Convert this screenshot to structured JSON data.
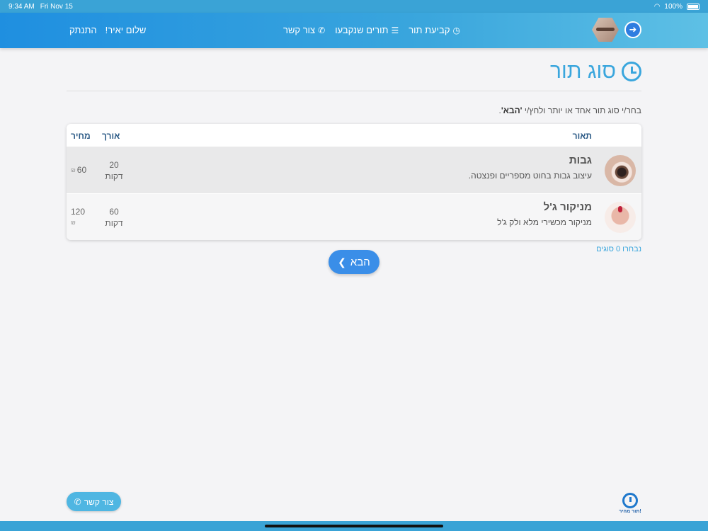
{
  "status_bar": {
    "time": "9:34 AM",
    "date": "Fri Nov 15",
    "battery": "100%"
  },
  "navbar": {
    "logout": "התנתק",
    "greeting": "שלום יאיר!",
    "items": [
      {
        "label": "קביעת תור",
        "icon": "clock-icon"
      },
      {
        "label": "תורים שנקבעו",
        "icon": "list-icon"
      },
      {
        "label": "צור קשר",
        "icon": "phone-icon"
      }
    ]
  },
  "page": {
    "title": "סוג תור",
    "instruction_prefix": "בחר/י סוג תור אחד או יותר ולחץ/י ",
    "instruction_bold": "'הבא'",
    "instruction_suffix": "."
  },
  "table": {
    "headers": {
      "description": "תאור",
      "length": "אורך",
      "price": "מחיר"
    },
    "rows": [
      {
        "name": "גבות",
        "description": "עיצוב גבות בחוט מספריים ופנצטה.",
        "length": "20",
        "length_unit": "דקות",
        "price": "60",
        "thumbnail": "eye-thumbnail"
      },
      {
        "name": "מניקור ג'ל",
        "description": "מניקור מכשירי מלא ולק ג'ל",
        "length": "60",
        "length_unit": "דקות",
        "price": "120",
        "thumbnail": "hand-thumbnail"
      }
    ]
  },
  "selected_count": "נבחרו 0 סוגים",
  "next_button": "הבא",
  "contact_button": "צור קשר",
  "brand_mini_label": "תור מהיר!"
}
